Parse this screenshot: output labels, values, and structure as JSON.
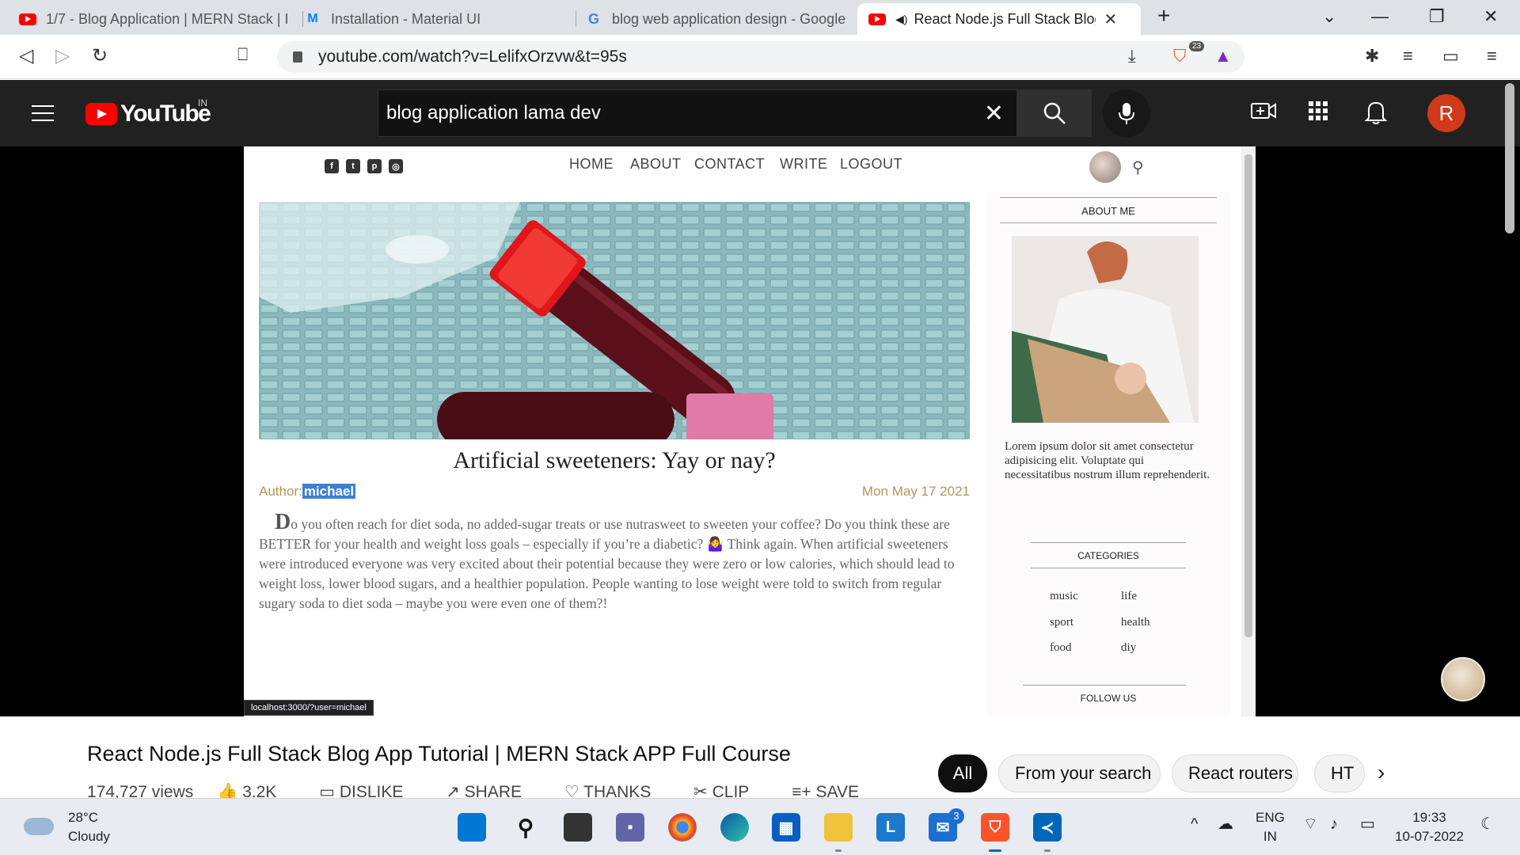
{
  "browser": {
    "tabs": [
      {
        "title": "1/7 - Blog Application | MERN Stack | I",
        "icon": "youtube-icon"
      },
      {
        "title": "Installation - Material UI",
        "icon": "mui-icon"
      },
      {
        "title": "blog web application design - Google",
        "icon": "google-icon"
      },
      {
        "title": "React Node.js Full Stack Blog A",
        "icon": "youtube-icon",
        "active": true
      }
    ],
    "url": "youtube.com/watch?v=LelifxOrzvw&t=95s",
    "brave_badge": "23"
  },
  "youtube": {
    "region": "IN",
    "logo_text": "YouTube",
    "search_value": "blog application lama dev",
    "avatar_letter": "R"
  },
  "blog": {
    "nav": [
      "HOME",
      "ABOUT",
      "CONTACT",
      "WRITE",
      "LOGOUT"
    ],
    "post": {
      "title": "Artificial sweeteners: Yay or nay?",
      "author_label": "Author:",
      "author_name": "michael",
      "date": "Mon May 17 2021",
      "drop_letter": "D",
      "body": "o you often reach for diet soda, no added-sugar treats or use nutrasweet to sweeten your coffee? Do you think these are BETTER for your health and weight loss goals – especially if you’re a diabetic? 🤷‍♀️ Think again. When artificial sweeteners were introduced everyone was very excited about their potential because they were zero or low calories, which should lead to weight loss, lower blood sugars, and a healthier population. People wanting to lose weight were told to switch from regular sugary soda to diet soda – maybe you were even one of them?!"
    },
    "sidebar": {
      "about_title": "ABOUT ME",
      "about_text": "Lorem ipsum dolor sit amet consectetur adipisicing elit. Voluptate qui necessitatibus nostrum illum reprehenderit.",
      "categories_title": "CATEGORIES",
      "categories": [
        "music",
        "life",
        "sport",
        "health",
        "food",
        "diy"
      ],
      "follow_title": "FOLLOW US"
    },
    "status_url": "localhost:3000/?user=michael"
  },
  "video": {
    "title": "React Node.js Full Stack Blog App Tutorial | MERN Stack APP Full Course",
    "views": "174,727 views",
    "likes": "3.2K",
    "dislike": "DISLIKE",
    "share": "SHARE",
    "thanks": "THANKS",
    "clip": "CLIP",
    "save": "SAVE",
    "chips": [
      "All",
      "From your search",
      "React routers",
      "HT"
    ]
  },
  "taskbar": {
    "temp": "28°C",
    "weather": "Cloudy",
    "mail_badge": "3",
    "lang1": "ENG",
    "lang2": "IN",
    "time": "19:33",
    "date": "10-07-2022"
  }
}
